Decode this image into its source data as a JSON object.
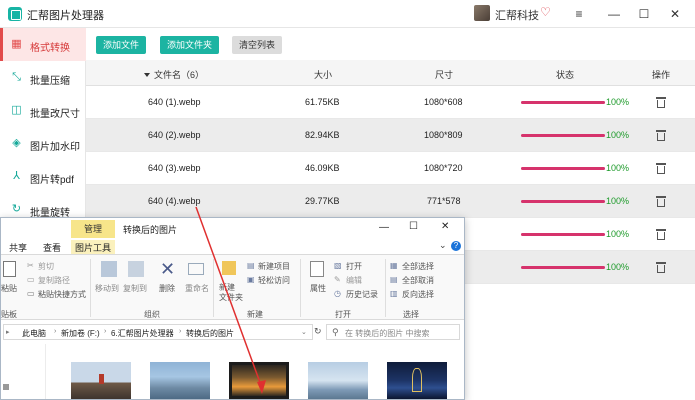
{
  "app": {
    "title": "汇帮图片处理器",
    "user_name": "汇帮科技",
    "colors": {
      "accent": "#1cb4a2",
      "active": "#e24b4b",
      "progress": "#d6336c",
      "percent": "#1d9a2a"
    }
  },
  "sidebar": {
    "items": [
      {
        "label": "格式转换",
        "icon": "format-convert-icon",
        "glyph": "▦"
      },
      {
        "label": "批量压缩",
        "icon": "compress-icon",
        "glyph": "⤡"
      },
      {
        "label": "批量改尺寸",
        "icon": "resize-icon",
        "glyph": "◫"
      },
      {
        "label": "图片加水印",
        "icon": "watermark-icon",
        "glyph": "◈"
      },
      {
        "label": "图片转pdf",
        "icon": "pdf-icon",
        "glyph": "⅄"
      },
      {
        "label": "批量旋转",
        "icon": "rotate-icon",
        "glyph": "↻"
      }
    ]
  },
  "toolbar": {
    "add_file": "添加文件",
    "add_folder": "添加文件夹",
    "clear_list": "清空列表"
  },
  "table": {
    "headers": {
      "name": "文件名（6）",
      "size": "大小",
      "dimensions": "尺寸",
      "status": "状态",
      "action": "操作"
    },
    "rows": [
      {
        "name": "640 (1).webp",
        "size": "61.75KB",
        "dimensions": "1080*608",
        "progress": 100,
        "percent": "100%"
      },
      {
        "name": "640 (2).webp",
        "size": "82.94KB",
        "dimensions": "1080*809",
        "progress": 100,
        "percent": "100%"
      },
      {
        "name": "640 (3).webp",
        "size": "46.09KB",
        "dimensions": "1080*720",
        "progress": 100,
        "percent": "100%"
      },
      {
        "name": "640 (4).webp",
        "size": "29.77KB",
        "dimensions": "771*578",
        "progress": 100,
        "percent": "100%"
      },
      {
        "name": "",
        "size": "",
        "dimensions": "",
        "progress": 100,
        "percent": "100%"
      },
      {
        "name": "",
        "size": "",
        "dimensions": "",
        "progress": 100,
        "percent": "100%"
      }
    ]
  },
  "explorer": {
    "manage_tab": "管理",
    "folder_title": "转换后的图片",
    "tabs": {
      "share": "共享",
      "view": "查看",
      "picture_tools": "图片工具"
    },
    "ribbon": {
      "paste": "粘贴",
      "cut": "剪切",
      "copy_path": "复制路径",
      "paste_shortcut": "粘贴快捷方式",
      "clipboard_group": "贴板",
      "move_to": "移动到",
      "copy_to": "复制到",
      "delete": "删除",
      "rename": "重命名",
      "organize_group": "组织",
      "new_item": "新建项目",
      "easy_access": "轻松访问",
      "new_folder": "新建\n文件夹",
      "new_group": "新建",
      "properties": "属性",
      "open": "打开",
      "edit": "编辑",
      "history": "历史记录",
      "open_group": "打开",
      "select_all": "全部选择",
      "select_none": "全部取消",
      "invert_selection": "反向选择",
      "select_group": "选择"
    },
    "breadcrumbs": [
      "此电脑",
      "新加卷 (F:)",
      "6.汇帮图片处理器",
      "转换后的图片"
    ],
    "search_placeholder": "在 转换后的图片 中搜索"
  }
}
